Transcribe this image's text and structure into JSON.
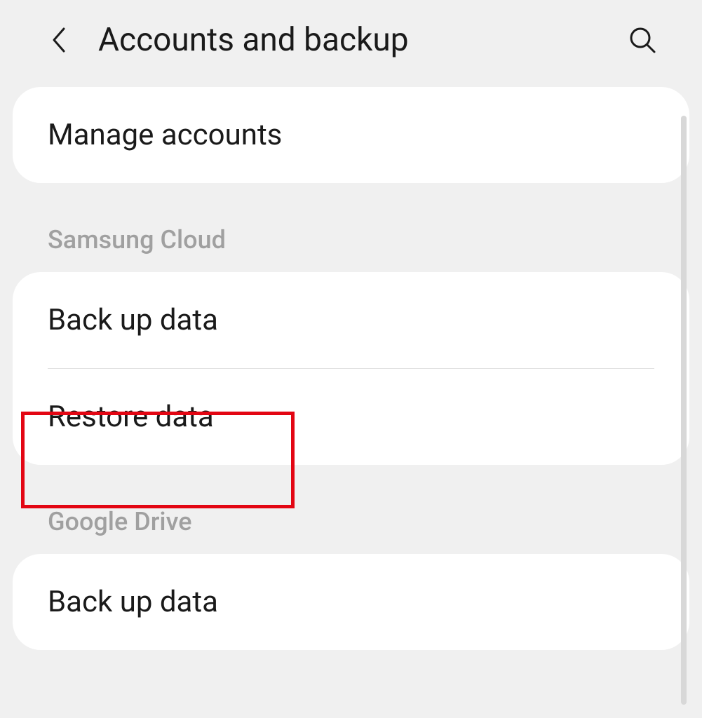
{
  "header": {
    "title": "Accounts and backup"
  },
  "sections": {
    "manage_accounts": "Manage accounts",
    "samsung_cloud": {
      "header": "Samsung Cloud",
      "backup": "Back up data",
      "restore": "Restore data"
    },
    "google_drive": {
      "header": "Google Drive",
      "backup": "Back up data"
    }
  }
}
